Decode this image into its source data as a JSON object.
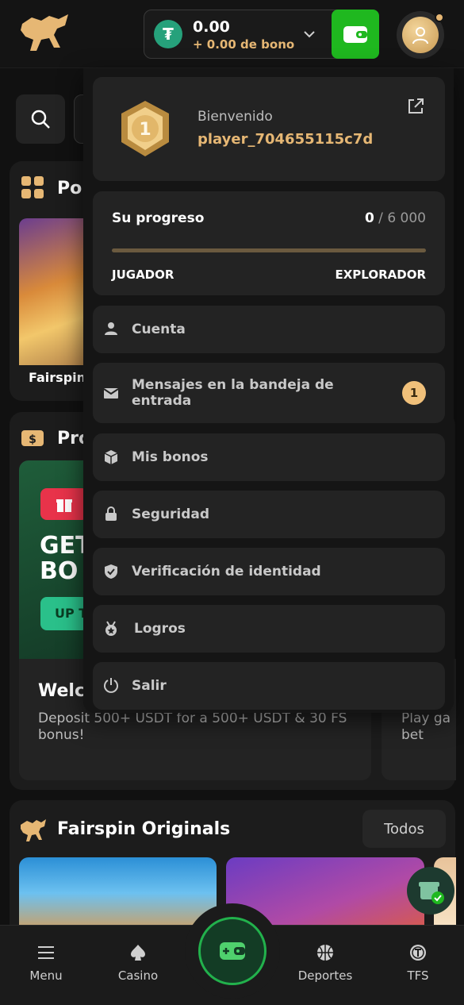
{
  "header": {
    "balance_amount": "0.00",
    "balance_bonus": "+ 0.00 de bono",
    "currency_icon": "tether-icon",
    "wallet_icon": "wallet-icon",
    "accent_color": "#e6b774",
    "wallet_color": "#1fb81f"
  },
  "background": {
    "popular_title": "Po",
    "popular_game_label": "Fairspin",
    "promos_title": "Pro",
    "promo_banner_text_line1": "GET",
    "promo_banner_text_line2": "BO",
    "promo_button": "UP T",
    "welcome_title": "Welc",
    "welcome_desc": "Deposit 500+ USDT for a 500+ USDT & 30 FS bonus!",
    "second_card_text_line1": "Play ga",
    "second_card_text_line2": "bet",
    "originals_title": "Fairspin Originals",
    "originals_all_button": "Todos"
  },
  "dropdown": {
    "welcome_label": "Bienvenido",
    "username": "player_704655115c7d",
    "level": "1",
    "progress": {
      "title": "Su progreso",
      "current": "0",
      "separator": " / ",
      "target": "6 000",
      "fraction": 0.0,
      "from_level": "JUGADOR",
      "to_level": "EXPLORADOR"
    },
    "items": [
      {
        "label": "Cuenta",
        "icon": "user-icon"
      },
      {
        "label": "Mensajes en la bandeja de entrada",
        "icon": "mail-icon",
        "badge": "1"
      },
      {
        "label": "Mis bonos",
        "icon": "cube-icon"
      },
      {
        "label": "Seguridad",
        "icon": "lock-icon"
      },
      {
        "label": "Verificación de identidad",
        "icon": "shield-check-icon"
      },
      {
        "label": "Logros",
        "icon": "medal-icon"
      },
      {
        "label": "Salir",
        "icon": "power-icon"
      }
    ]
  },
  "bottom_nav": {
    "items": [
      {
        "label": "Menu",
        "icon": "hamburger-icon"
      },
      {
        "label": "Casino",
        "icon": "spade-icon"
      },
      {
        "label": "Deportes",
        "icon": "basketball-icon"
      },
      {
        "label": "TFS",
        "icon": "tfs-coin-icon"
      }
    ],
    "center_icon": "wallet-plus-icon"
  }
}
